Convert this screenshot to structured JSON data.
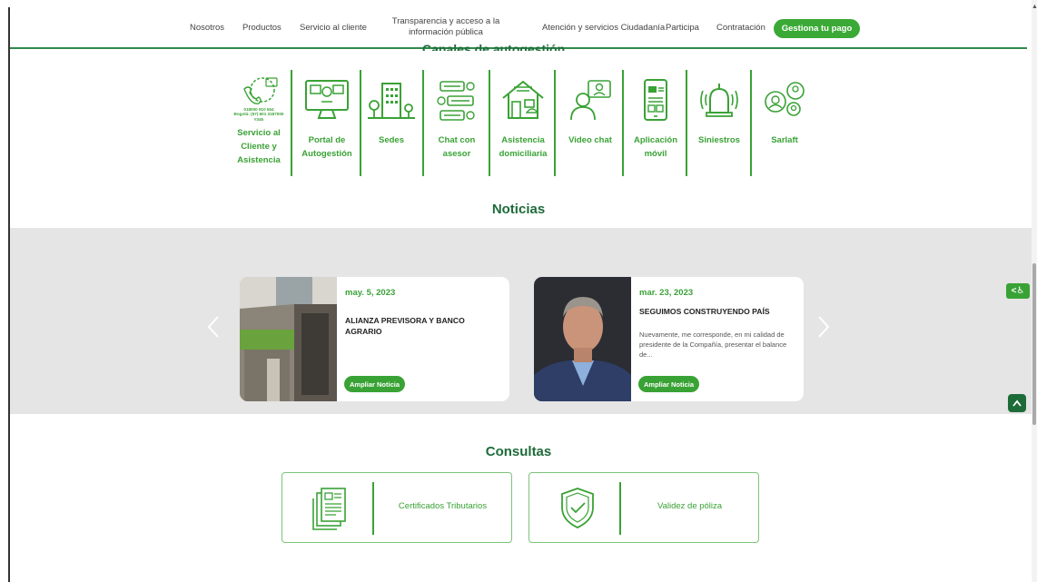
{
  "nav": {
    "items": [
      "Nosotros",
      "Productos",
      "Servicio al cliente"
    ],
    "transparencia": [
      "Transparencia y acceso a la",
      "información pública"
    ],
    "items2": [
      "Atención y servicios Ciudadanía",
      "Participa",
      "Contratación"
    ],
    "cta": "Gestiona tu pago"
  },
  "channels": {
    "section_title_cut": "Canales de autogestión",
    "phone_text": [
      "018000 910 554",
      "Bogotá: (57) 601 3187000",
      "#345"
    ],
    "items": [
      {
        "label": [
          "Servicio al",
          "Cliente y",
          "Asistencia"
        ],
        "icon": "phone-support-icon"
      },
      {
        "label": [
          "Portal de",
          "Autogestión"
        ],
        "icon": "monitor-portal-icon"
      },
      {
        "label": [
          "Sedes"
        ],
        "icon": "building-icon"
      },
      {
        "label": [
          "Chat con",
          "asesor"
        ],
        "icon": "chat-icon"
      },
      {
        "label": [
          "Asistencia",
          "domiciliaria"
        ],
        "icon": "house-icon"
      },
      {
        "label": [
          "Video chat"
        ],
        "icon": "video-chat-icon"
      },
      {
        "label": [
          "Aplicación",
          "móvil"
        ],
        "icon": "mobile-app-icon"
      },
      {
        "label": [
          "Siniestros"
        ],
        "icon": "alarm-bell-icon"
      },
      {
        "label": [
          "Sarlaft"
        ],
        "icon": "people-network-icon"
      }
    ]
  },
  "news": {
    "heading": "Noticias",
    "cards": [
      {
        "date": "may. 5, 2023",
        "title": "ALIANZA PREVISORA Y BANCO AGRARIO",
        "summary": "",
        "button": "Ampliar Noticia"
      },
      {
        "date": "mar. 23, 2023",
        "title": "SEGUIMOS CONSTRUYENDO PAÍS",
        "summary": "Nuevamente, me corresponde, en mi calidad de presidente de la Compañía, presentar el balance de...",
        "button": "Ampliar Noticia"
      }
    ],
    "prev_icon": "chevron-left-icon",
    "next_icon": "chevron-right-icon"
  },
  "side": {
    "accessibility_label": "<♿",
    "back_to_top_icon": "chevron-up-icon"
  },
  "consultas": {
    "heading": "Consultas",
    "items": [
      {
        "label": "Certificados Tributarios",
        "icon": "documents-icon"
      },
      {
        "label": "Validez de póliza",
        "icon": "shield-check-icon"
      }
    ]
  },
  "colors": {
    "brand_green": "#39a235",
    "dark_green": "#1e6b3a",
    "band_gray": "#e5e5e5"
  }
}
